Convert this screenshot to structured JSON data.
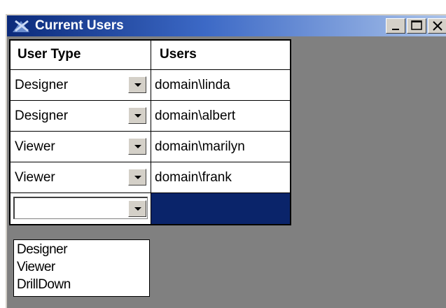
{
  "window": {
    "title": "Current Users"
  },
  "grid": {
    "headers": {
      "user_type": "User Type",
      "users": "Users"
    },
    "rows": [
      {
        "user_type": "Designer",
        "user": "domain\\linda"
      },
      {
        "user_type": "Designer",
        "user": "domain\\albert"
      },
      {
        "user_type": "Viewer",
        "user": "domain\\marilyn"
      },
      {
        "user_type": "Viewer",
        "user": "domain\\frank"
      }
    ],
    "new_row": {
      "user_type": "",
      "user": ""
    }
  },
  "dropdown": {
    "options": [
      "Designer",
      "Viewer",
      "DrillDown"
    ]
  },
  "colors": {
    "titlebar_start": "#0b2a7a",
    "titlebar_end": "#a9c2ea",
    "selection": "#0a246a",
    "background": "#808080"
  }
}
